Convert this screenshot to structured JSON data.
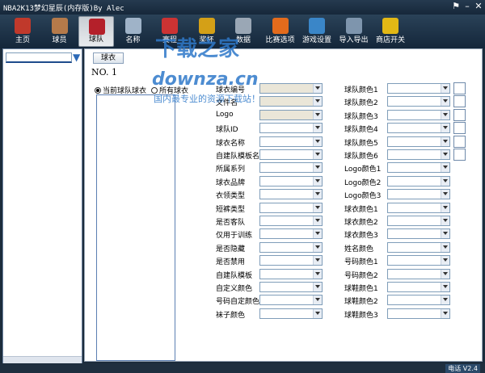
{
  "window": {
    "title": "NBA2K13梦幻星辰(内存版)By Alec",
    "controls": [
      "shirt-icon",
      "minimize-icon",
      "close-icon"
    ]
  },
  "toolbar": {
    "items": [
      {
        "label": "主页",
        "icon": "home-icon",
        "color": "#c0392b"
      },
      {
        "label": "球员",
        "icon": "player-icon",
        "color": "#b57a4a"
      },
      {
        "label": "球队",
        "icon": "team-icon",
        "color": "#b4202a"
      },
      {
        "label": "名称",
        "icon": "signature-icon",
        "color": "#9fb3c8"
      },
      {
        "label": "赛程",
        "icon": "calendar-icon",
        "color": "#c33"
      },
      {
        "label": "奖杯",
        "icon": "trophy-icon",
        "color": "#d4a017"
      },
      {
        "label": "数据",
        "icon": "stats-icon",
        "color": "#9aa7b5"
      },
      {
        "label": "比赛选项",
        "icon": "gatorade-icon",
        "color": "#e36b1c"
      },
      {
        "label": "游戏设置",
        "icon": "gear-icon",
        "color": "#3a86c8"
      },
      {
        "label": "导入导出",
        "icon": "download-icon",
        "color": "#7e95ad"
      },
      {
        "label": "商店开关",
        "icon": "dollar-icon",
        "color": "#e2b815"
      }
    ]
  },
  "main": {
    "subtab": "球衣",
    "number": "NO. 1",
    "radio_current": "当前球队球衣",
    "radio_all": "所有球衣",
    "left_fields": [
      "球衣编号",
      "文件名",
      "Logo",
      "球队ID",
      "球衣名称",
      "自建队模板名",
      "所属系列",
      "球衣品牌",
      "衣领类型",
      "短裤类型",
      "是否客队",
      "仅用于训练",
      "是否隐藏",
      "是否禁用",
      "自建队模板",
      "自定义颜色",
      "号码自定颜色",
      "袜子颜色"
    ],
    "right_fields": [
      "球队颜色1",
      "球队颜色2",
      "球队颜色3",
      "球队颜色4",
      "球队颜色5",
      "球队颜色6",
      "Logo颜色1",
      "Logo颜色2",
      "Logo颜色3",
      "球衣颜色1",
      "球衣颜色2",
      "球衣颜色3",
      "姓名颜色",
      "号码颜色1",
      "号码颜色2",
      "球鞋颜色1",
      "球鞋颜色2",
      "球鞋颜色3"
    ]
  },
  "watermark": {
    "line1": "下载之家",
    "line2": "downza.cn",
    "line3": "国内最专业的资源下载站！"
  },
  "status": {
    "info": "电话  V2.4"
  }
}
